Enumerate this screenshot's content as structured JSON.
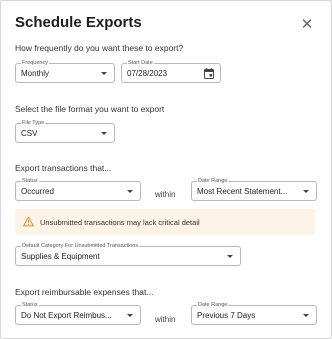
{
  "dialog": {
    "title": "Schedule Exports",
    "close_glyph": "✕"
  },
  "frequency_section": {
    "question": "How frequently do you want these to export?",
    "frequency": {
      "label": "Frequency",
      "value": "Monthly"
    },
    "start_date": {
      "label": "Start Date",
      "value": "07/28/2023",
      "icon": "calendar-icon"
    }
  },
  "format_section": {
    "question": "Select the file format you want to export",
    "file_type": {
      "label": "File Type",
      "value": "CSV"
    }
  },
  "transactions_section": {
    "heading": "Export transactions that...",
    "status": {
      "label": "Status",
      "value": "Occurred"
    },
    "connector": "within",
    "date_range": {
      "label": "Date Range",
      "value": "Most Recent Statement..."
    },
    "warning": {
      "icon": "warning-icon",
      "text": "Unsubmitted transactions may lack critical detail",
      "color": "#e8912d",
      "background": "#fdf3e6"
    },
    "default_category": {
      "label": "Default Category For Unsubmitted Transactions",
      "value": "Supplies & Equipment"
    }
  },
  "reimbursable_section": {
    "heading": "Export reimbursable expenses that...",
    "status": {
      "label": "Status",
      "value": "Do Not Export Reimbus..."
    },
    "connector": "within",
    "date_range": {
      "label": "Date Range",
      "value": "Previous 7 Days"
    }
  }
}
